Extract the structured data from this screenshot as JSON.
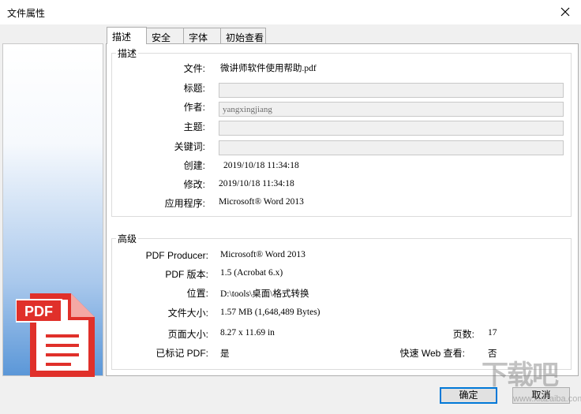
{
  "window": {
    "title": "文件属性",
    "close_icon": "close-icon"
  },
  "tabs": [
    {
      "label": "描述",
      "active": true
    },
    {
      "label": "安全",
      "active": false
    },
    {
      "label": "字体",
      "active": false
    },
    {
      "label": "初始查看",
      "active": false
    }
  ],
  "description": {
    "group_title": "描述",
    "file_label": "文件:",
    "file_value": "微讲师软件使用帮助.pdf",
    "title_label": "标题:",
    "title_value": "",
    "author_label": "作者:",
    "author_value": "yangxingjiang",
    "subject_label": "主题:",
    "subject_value": "",
    "keywords_label": "关键词:",
    "keywords_value": "",
    "created_label": "创建:",
    "created_value": "2019/10/18 11:34:18",
    "modified_label": "修改:",
    "modified_value": "2019/10/18 11:34:18",
    "app_label": "应用程序:",
    "app_value": "Microsoft® Word 2013"
  },
  "advanced": {
    "group_title": "高级",
    "producer_label": "PDF Producer:",
    "producer_value": "Microsoft® Word 2013",
    "version_label": "PDF 版本:",
    "version_value": "1.5 (Acrobat 6.x)",
    "location_label": "位置:",
    "location_value": "D:\\tools\\桌面\\格式转换",
    "size_label": "文件大小:",
    "size_value": "1.57 MB (1,648,489 Bytes)",
    "page_size_label": "页面大小:",
    "page_size_value": "8.27 x 11.69 in",
    "pages_label": "页数:",
    "pages_value": "17",
    "tagged_label": "已标记 PDF:",
    "tagged_value": "是",
    "fastweb_label": "快速 Web 查看:",
    "fastweb_value": "否"
  },
  "buttons": {
    "ok": "确定",
    "cancel": "取消"
  },
  "sidebar": {
    "pdf_icon_text": "PDF"
  },
  "watermark": {
    "text": "下载吧",
    "url": "www.xiazaiba.com"
  },
  "colors": {
    "accent": "#0078d7",
    "pdf_red": "#e0302a",
    "gradient_bottom": "#5b97d8"
  }
}
